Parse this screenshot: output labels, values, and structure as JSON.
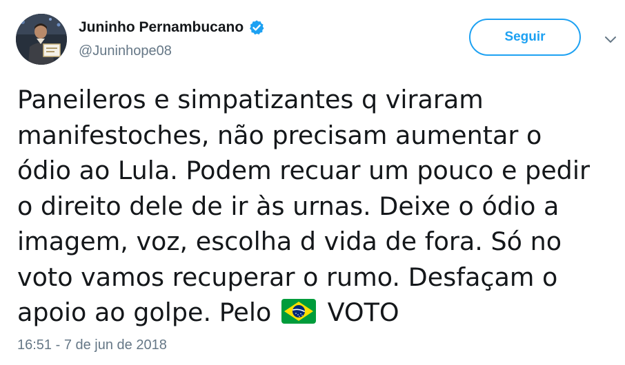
{
  "author": {
    "display_name": "Juninho Pernambucano",
    "handle": "@Juninhope08",
    "verified": true,
    "avatar_icon": "profile-photo"
  },
  "follow_button": {
    "label": "Seguir"
  },
  "more_menu": {
    "icon": "chevron-down-icon"
  },
  "tweet": {
    "lines": [
      "Paneileros e simpatizantes q viraram",
      "manifestoches, não precisam aumentar o",
      "ódio ao Lula. Podem recuar um pouco e pedir",
      "o direito dele de ir às urnas. Deixe o ódio a",
      "imagem, voz, escolha d vida de fora. Só no",
      "voto vamos recuperar o rumo. Desfaçam o"
    ],
    "last_line_before_emoji": "apoio ao golpe. Pelo",
    "emoji": "brazil-flag-emoji",
    "last_line_after_emoji": "VOTO",
    "timestamp": "16:51 - 7 de jun de 2018"
  },
  "colors": {
    "accent": "#1da1f2",
    "text": "#14171a",
    "secondary_text": "#657786"
  }
}
